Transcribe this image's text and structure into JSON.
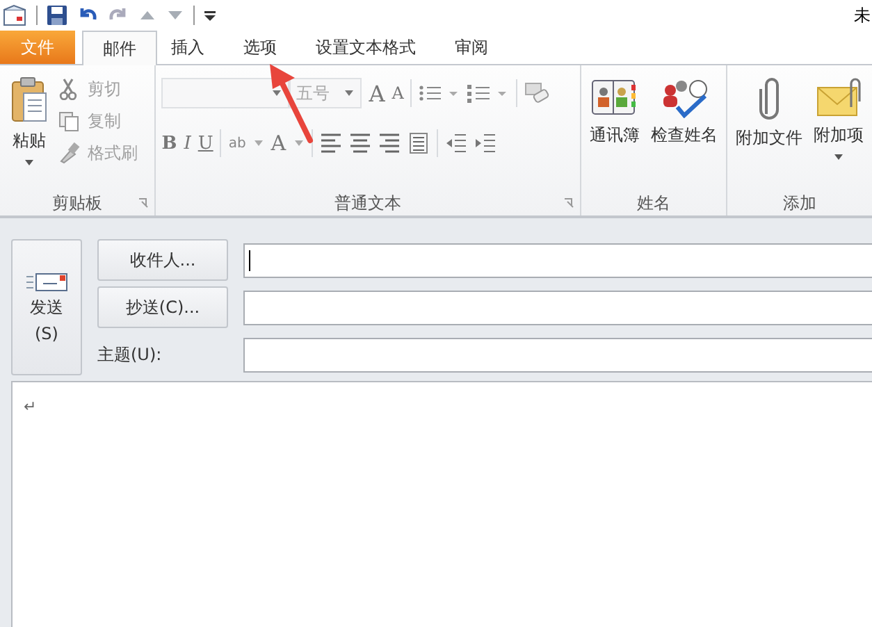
{
  "window": {
    "title": "未"
  },
  "tabs": [
    {
      "label": "文件",
      "kind": "file",
      "selected": false
    },
    {
      "label": "邮件",
      "kind": "tab",
      "selected": true
    },
    {
      "label": "插入",
      "kind": "tab",
      "selected": false
    },
    {
      "label": "选项",
      "kind": "tab",
      "selected": false
    },
    {
      "label": "设置文本格式",
      "kind": "tab",
      "selected": false
    },
    {
      "label": "审阅",
      "kind": "tab",
      "selected": false
    }
  ],
  "clipboard": {
    "label": "剪贴板",
    "paste": "粘贴",
    "items": [
      {
        "label": "剪切",
        "kind": "cut",
        "disabled": true
      },
      {
        "label": "复制",
        "kind": "copy",
        "disabled": true
      },
      {
        "label": "格式刷",
        "kind": "painter",
        "disabled": true
      }
    ]
  },
  "basic_text": {
    "label": "普通文本",
    "font_size": "五号",
    "grow": "A",
    "shrink": "A",
    "bold": "B",
    "italic": "I",
    "underline": "U",
    "highlight": "ab",
    "font_color": "A"
  },
  "names": {
    "label": "姓名",
    "buttons": [
      {
        "label": "通讯簿",
        "kind": "book"
      },
      {
        "label": "检查姓名",
        "kind": "check"
      }
    ]
  },
  "include": {
    "label": "添加",
    "buttons": [
      {
        "label": "附加文件",
        "kind": "clip"
      },
      {
        "label": "附加项",
        "kind": "envelope"
      }
    ]
  },
  "compose": {
    "send": "发送",
    "send_key": "(S)",
    "to": "收件人...",
    "cc": "抄送(C)...",
    "subject": "主题(U):"
  },
  "body": {
    "mark": "↵"
  }
}
